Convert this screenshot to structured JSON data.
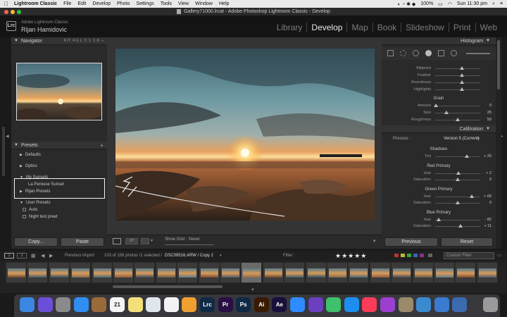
{
  "menubar": {
    "app": "Lightroom Classic",
    "items": [
      "File",
      "Edit",
      "Develop",
      "Photo",
      "Settings",
      "Tools",
      "View",
      "Window",
      "Help"
    ],
    "battery": "100%",
    "clock": "Sun 11:30 pm"
  },
  "window": {
    "title": "Gallery71000.lrcat - Adobe Photoshop Lightroom Classic - Develop"
  },
  "identity": {
    "app": "Adobe Lightroom Classic",
    "user": "Rijan Hamidovic",
    "badge": "Lrc"
  },
  "modules": [
    "Library",
    "Develop",
    "Map",
    "Book",
    "Slideshow",
    "Print",
    "Web"
  ],
  "navigator": {
    "title": "Navigator",
    "options": "FIT FILL 1:1 1:6 ÷"
  },
  "presets": {
    "title": "Presets",
    "rows": [
      {
        "label": "Defaults",
        "kind": "group"
      },
      {
        "label": "Optics",
        "kind": "group"
      },
      {
        "label": "My Sunsets",
        "kind": "open"
      },
      {
        "label": "La Perouse Sunset",
        "kind": "item"
      },
      {
        "label": "Rijan Presets",
        "kind": "group"
      },
      {
        "label": "User Presets",
        "kind": "open"
      },
      {
        "label": "Auto",
        "kind": "item"
      },
      {
        "label": "Night test preet",
        "kind": "item"
      }
    ]
  },
  "left_buttons": {
    "copy": "Copy...",
    "paste": "Paste"
  },
  "right": {
    "histogram": "Histogram",
    "effects_sliders": [
      {
        "label": "Midpoint",
        "pos": 0.6
      },
      {
        "label": "Feather",
        "pos": 0.6
      },
      {
        "label": "Roundness",
        "pos": 0.6
      },
      {
        "label": "Highlights",
        "pos": 0.6
      }
    ],
    "grain": {
      "title": "Grain",
      "sliders": [
        {
          "label": "Amount",
          "value": "0",
          "pos": 0.02
        },
        {
          "label": "Size",
          "value": "25",
          "pos": 0.25
        },
        {
          "label": "Roughness",
          "value": "50",
          "pos": 0.5
        }
      ]
    },
    "calibration": {
      "title": "Calibration",
      "process_label": "Process :",
      "process_value": "Version 5 (Current)",
      "groups": [
        {
          "title": "Shadows",
          "rows": [
            {
              "label": "Tint",
              "value": "+ 25",
              "pos": 0.7
            }
          ]
        },
        {
          "title": "Red Primary",
          "rows": [
            {
              "label": "Hue",
              "value": "+ 2",
              "pos": 0.52
            },
            {
              "label": "Saturation",
              "value": "0",
              "pos": 0.5
            }
          ]
        },
        {
          "title": "Green Primary",
          "rows": [
            {
              "label": "Hue",
              "value": "+ 65",
              "pos": 0.82
            },
            {
              "label": "Saturation",
              "value": "0",
              "pos": 0.5
            }
          ]
        },
        {
          "title": "Blue Primary",
          "rows": [
            {
              "label": "Hue",
              "value": "- 82",
              "pos": 0.08
            },
            {
              "label": "Saturation",
              "value": "+ 11",
              "pos": 0.56
            }
          ]
        }
      ]
    },
    "buttons": {
      "previous": "Previous",
      "reset": "Reset"
    }
  },
  "toolbar": {
    "show_grid_label": "Show Grid :",
    "show_grid_value": "Never"
  },
  "filmstrip_bar": {
    "pages": [
      "1",
      "2"
    ],
    "source": "Previous Import",
    "count": "103 of 156 photos /1 selected /",
    "file": "DSC09516.ARW / Copy 2",
    "filter_label": "Filter :",
    "stars": "★★★★★",
    "custom_filter": "Custom Filter"
  },
  "dock": {
    "apps": [
      {
        "name": "Finder",
        "label": "",
        "color": "#3b86e0"
      },
      {
        "name": "Siri",
        "label": "",
        "color": "#6c4fd8"
      },
      {
        "name": "Launchpad",
        "label": "",
        "color": "#8a8a8a"
      },
      {
        "name": "Safari",
        "label": "",
        "color": "#2f8ef0"
      },
      {
        "name": "Notes Book",
        "label": "",
        "color": "#9b6a3a"
      },
      {
        "name": "Calendar",
        "label": "21",
        "color": "#f5f5f5"
      },
      {
        "name": "Notes",
        "label": "",
        "color": "#f3e07a"
      },
      {
        "name": "Preview",
        "label": "",
        "color": "#dfe6ee"
      },
      {
        "name": "Reminders",
        "label": "",
        "color": "#f3f3f3"
      },
      {
        "name": "Photos",
        "label": "",
        "color": "#f0a030"
      },
      {
        "name": "Lightroom",
        "label": "Lrc",
        "color": "#0f2a45"
      },
      {
        "name": "Premiere",
        "label": "Pr",
        "color": "#2a0f45"
      },
      {
        "name": "Photoshop",
        "label": "Ps",
        "color": "#0f2a45"
      },
      {
        "name": "Illustrator",
        "label": "Ai",
        "color": "#3a1a00"
      },
      {
        "name": "After Effects",
        "label": "Ae",
        "color": "#1a0f3a"
      },
      {
        "name": "Zoom",
        "label": "",
        "color": "#2d8cff"
      },
      {
        "name": "Visual Studio",
        "label": "",
        "color": "#6a3fc0"
      },
      {
        "name": "Messages",
        "label": "",
        "color": "#3fc06a"
      },
      {
        "name": "App Store",
        "label": "",
        "color": "#1c8ef0"
      },
      {
        "name": "Music",
        "label": "",
        "color": "#fa3c5a"
      },
      {
        "name": "Podcasts",
        "label": "",
        "color": "#9b3fd0"
      },
      {
        "name": "Script Editor",
        "label": "",
        "color": "#9a8a6a"
      },
      {
        "name": "Feedback",
        "label": "",
        "color": "#3a8ad0"
      },
      {
        "name": "Migration",
        "label": "",
        "color": "#3a7ad0"
      },
      {
        "name": "Photo Booth",
        "label": "",
        "color": "#3a6ab0"
      },
      {
        "name": "Trash",
        "label": "",
        "color": "#9a9a9a"
      }
    ]
  }
}
